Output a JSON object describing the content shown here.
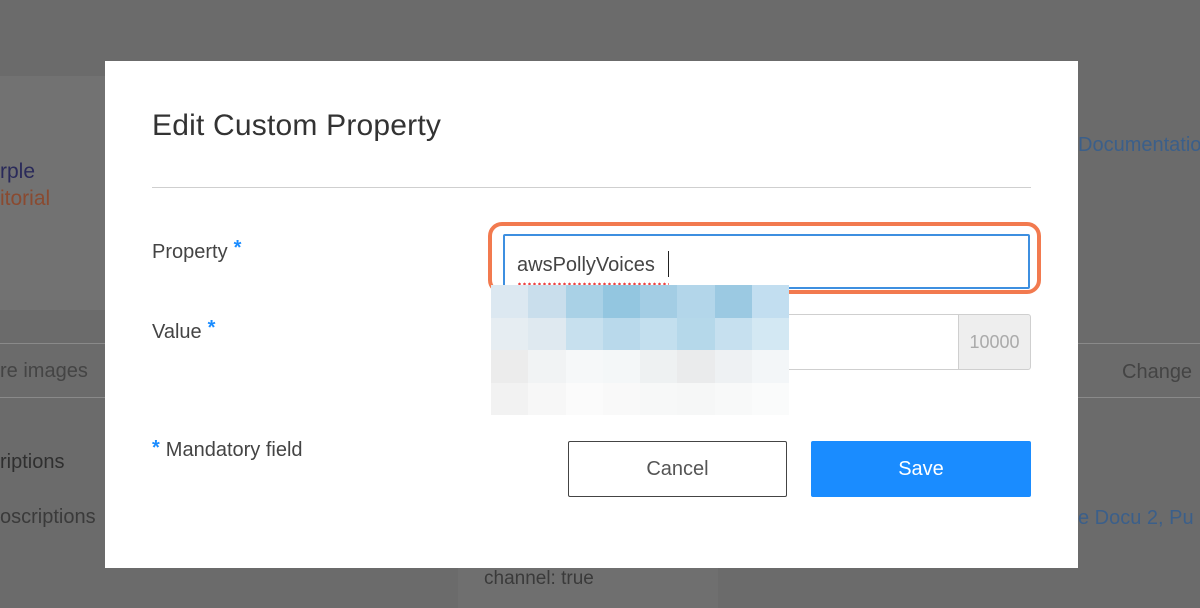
{
  "background": {
    "title_fragment": "rple",
    "subtitle_fragment": "itorial",
    "documentation_link": "Documentation",
    "tab_images": "re images",
    "tab_change": "Change",
    "section_subscriptions": "riptions",
    "row_subscriptions": "oscriptions",
    "row_docu": "e Docu 2, Pu",
    "channel_text": "channel: true"
  },
  "modal": {
    "title": "Edit Custom Property",
    "property_label": "Property",
    "property_value": "awsPollyVoices",
    "value_label": "Value",
    "value_addon": "10000",
    "required_marker": "*",
    "mandatory_note": "Mandatory field",
    "cancel_label": "Cancel",
    "save_label": "Save"
  },
  "colors": {
    "accent": "#1a8cff",
    "highlight": "#f27a4f",
    "overlay": "#6b6b6b"
  }
}
